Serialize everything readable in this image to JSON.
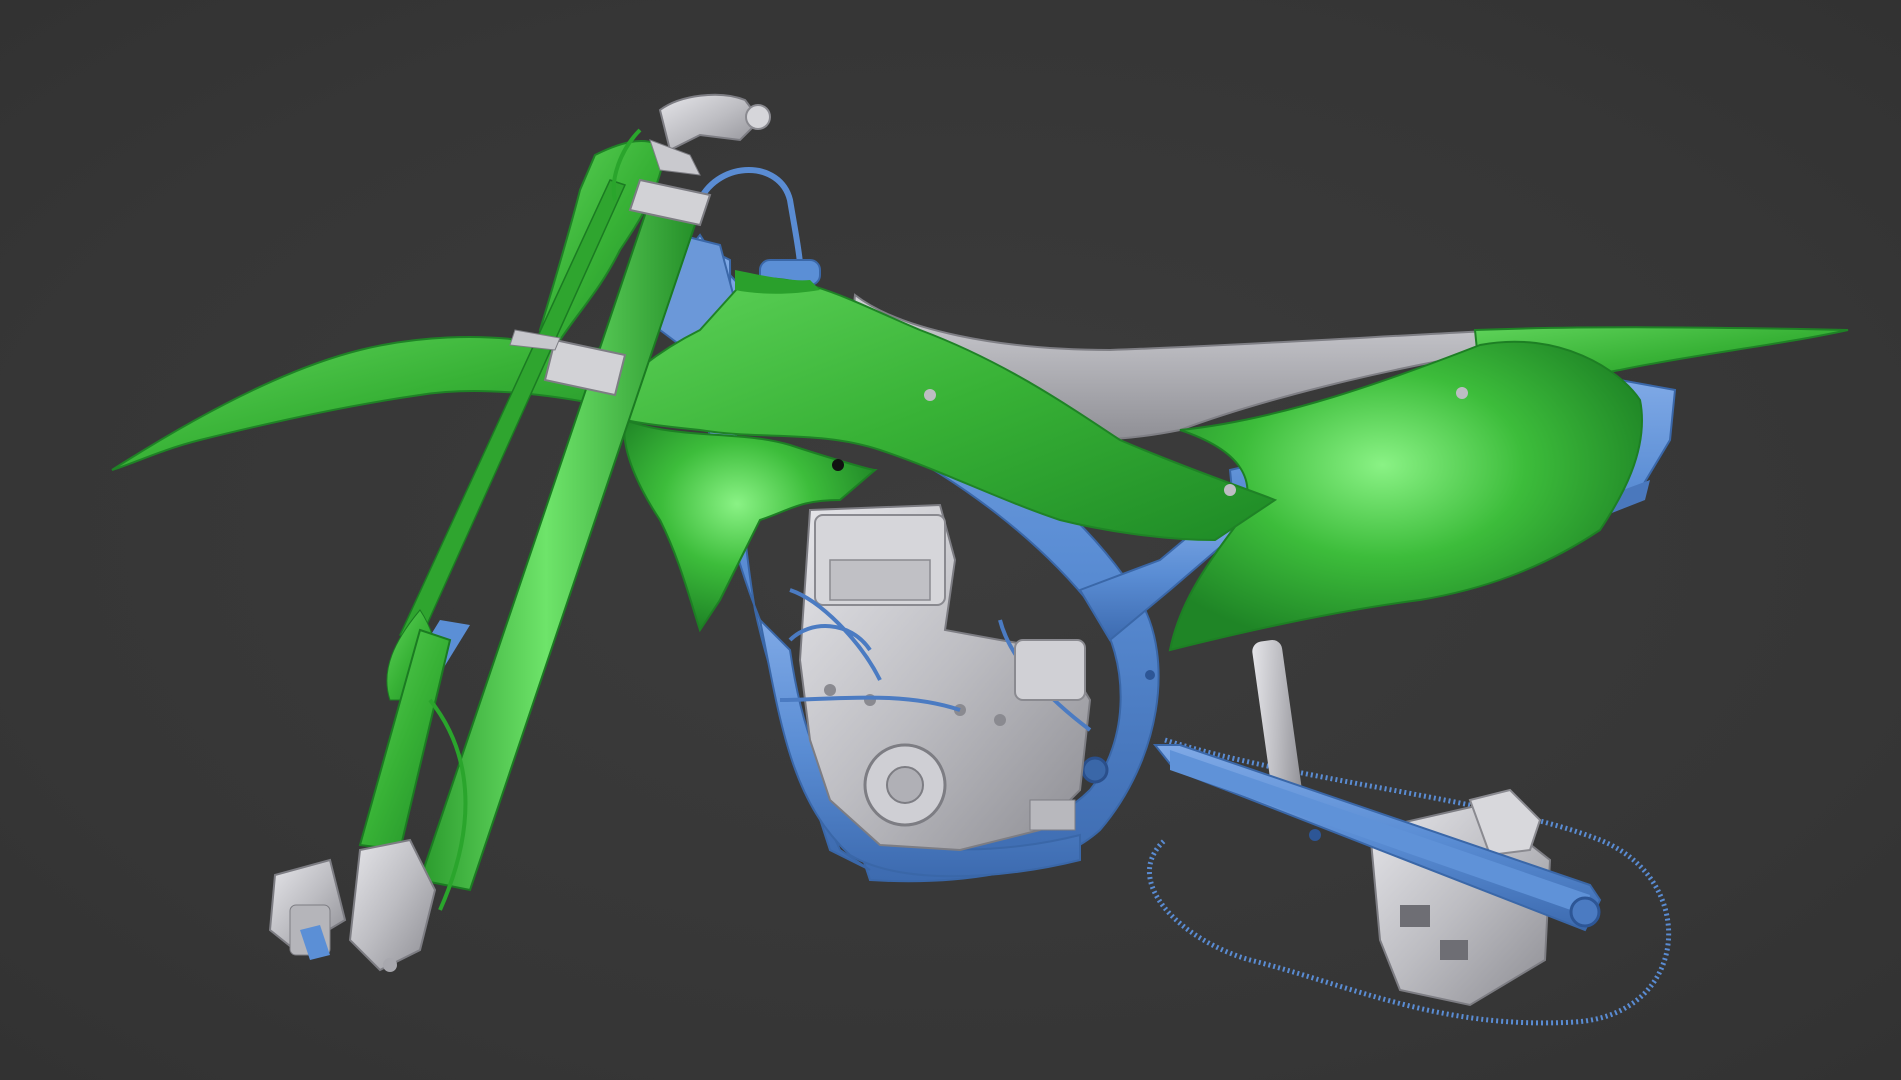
{
  "viewport": {
    "background": "#383838",
    "object": "motorcycle-model-icon"
  },
  "colors": {
    "body_green": "#3cb83a",
    "body_green_dark": "#1f8a26",
    "body_green_light": "#6fe06a",
    "frame_blue": "#5b8fd6",
    "frame_blue_dark": "#3a69ad",
    "engine_gray": "#c8c8cc",
    "engine_gray_dark": "#8e8e94",
    "seat_gray": "#b9b9bf"
  }
}
